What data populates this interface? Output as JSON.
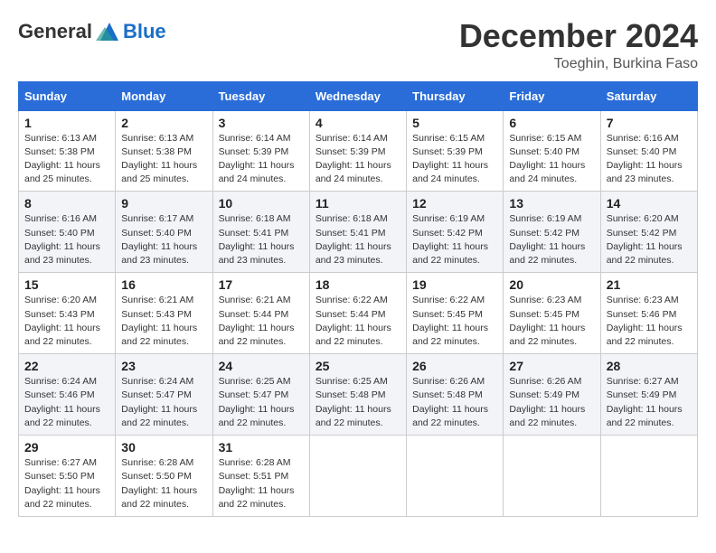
{
  "header": {
    "logo_general": "General",
    "logo_blue": "Blue",
    "month": "December 2024",
    "location": "Toeghin, Burkina Faso"
  },
  "columns": [
    "Sunday",
    "Monday",
    "Tuesday",
    "Wednesday",
    "Thursday",
    "Friday",
    "Saturday"
  ],
  "weeks": [
    [
      {
        "day": "1",
        "info": "Sunrise: 6:13 AM\nSunset: 5:38 PM\nDaylight: 11 hours\nand 25 minutes."
      },
      {
        "day": "2",
        "info": "Sunrise: 6:13 AM\nSunset: 5:38 PM\nDaylight: 11 hours\nand 25 minutes."
      },
      {
        "day": "3",
        "info": "Sunrise: 6:14 AM\nSunset: 5:39 PM\nDaylight: 11 hours\nand 24 minutes."
      },
      {
        "day": "4",
        "info": "Sunrise: 6:14 AM\nSunset: 5:39 PM\nDaylight: 11 hours\nand 24 minutes."
      },
      {
        "day": "5",
        "info": "Sunrise: 6:15 AM\nSunset: 5:39 PM\nDaylight: 11 hours\nand 24 minutes."
      },
      {
        "day": "6",
        "info": "Sunrise: 6:15 AM\nSunset: 5:40 PM\nDaylight: 11 hours\nand 24 minutes."
      },
      {
        "day": "7",
        "info": "Sunrise: 6:16 AM\nSunset: 5:40 PM\nDaylight: 11 hours\nand 23 minutes."
      }
    ],
    [
      {
        "day": "8",
        "info": "Sunrise: 6:16 AM\nSunset: 5:40 PM\nDaylight: 11 hours\nand 23 minutes."
      },
      {
        "day": "9",
        "info": "Sunrise: 6:17 AM\nSunset: 5:40 PM\nDaylight: 11 hours\nand 23 minutes."
      },
      {
        "day": "10",
        "info": "Sunrise: 6:18 AM\nSunset: 5:41 PM\nDaylight: 11 hours\nand 23 minutes."
      },
      {
        "day": "11",
        "info": "Sunrise: 6:18 AM\nSunset: 5:41 PM\nDaylight: 11 hours\nand 23 minutes."
      },
      {
        "day": "12",
        "info": "Sunrise: 6:19 AM\nSunset: 5:42 PM\nDaylight: 11 hours\nand 22 minutes."
      },
      {
        "day": "13",
        "info": "Sunrise: 6:19 AM\nSunset: 5:42 PM\nDaylight: 11 hours\nand 22 minutes."
      },
      {
        "day": "14",
        "info": "Sunrise: 6:20 AM\nSunset: 5:42 PM\nDaylight: 11 hours\nand 22 minutes."
      }
    ],
    [
      {
        "day": "15",
        "info": "Sunrise: 6:20 AM\nSunset: 5:43 PM\nDaylight: 11 hours\nand 22 minutes."
      },
      {
        "day": "16",
        "info": "Sunrise: 6:21 AM\nSunset: 5:43 PM\nDaylight: 11 hours\nand 22 minutes."
      },
      {
        "day": "17",
        "info": "Sunrise: 6:21 AM\nSunset: 5:44 PM\nDaylight: 11 hours\nand 22 minutes."
      },
      {
        "day": "18",
        "info": "Sunrise: 6:22 AM\nSunset: 5:44 PM\nDaylight: 11 hours\nand 22 minutes."
      },
      {
        "day": "19",
        "info": "Sunrise: 6:22 AM\nSunset: 5:45 PM\nDaylight: 11 hours\nand 22 minutes."
      },
      {
        "day": "20",
        "info": "Sunrise: 6:23 AM\nSunset: 5:45 PM\nDaylight: 11 hours\nand 22 minutes."
      },
      {
        "day": "21",
        "info": "Sunrise: 6:23 AM\nSunset: 5:46 PM\nDaylight: 11 hours\nand 22 minutes."
      }
    ],
    [
      {
        "day": "22",
        "info": "Sunrise: 6:24 AM\nSunset: 5:46 PM\nDaylight: 11 hours\nand 22 minutes."
      },
      {
        "day": "23",
        "info": "Sunrise: 6:24 AM\nSunset: 5:47 PM\nDaylight: 11 hours\nand 22 minutes."
      },
      {
        "day": "24",
        "info": "Sunrise: 6:25 AM\nSunset: 5:47 PM\nDaylight: 11 hours\nand 22 minutes."
      },
      {
        "day": "25",
        "info": "Sunrise: 6:25 AM\nSunset: 5:48 PM\nDaylight: 11 hours\nand 22 minutes."
      },
      {
        "day": "26",
        "info": "Sunrise: 6:26 AM\nSunset: 5:48 PM\nDaylight: 11 hours\nand 22 minutes."
      },
      {
        "day": "27",
        "info": "Sunrise: 6:26 AM\nSunset: 5:49 PM\nDaylight: 11 hours\nand 22 minutes."
      },
      {
        "day": "28",
        "info": "Sunrise: 6:27 AM\nSunset: 5:49 PM\nDaylight: 11 hours\nand 22 minutes."
      }
    ],
    [
      {
        "day": "29",
        "info": "Sunrise: 6:27 AM\nSunset: 5:50 PM\nDaylight: 11 hours\nand 22 minutes."
      },
      {
        "day": "30",
        "info": "Sunrise: 6:28 AM\nSunset: 5:50 PM\nDaylight: 11 hours\nand 22 minutes."
      },
      {
        "day": "31",
        "info": "Sunrise: 6:28 AM\nSunset: 5:51 PM\nDaylight: 11 hours\nand 22 minutes."
      },
      null,
      null,
      null,
      null
    ]
  ]
}
